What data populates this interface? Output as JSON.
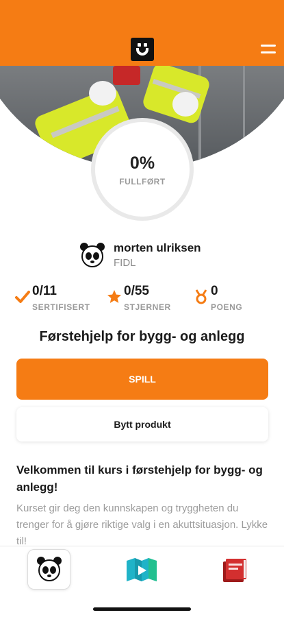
{
  "header": {
    "logo_icon": "smiley-logo-icon",
    "menu_icon": "hamburger-menu-icon",
    "accent_color": "#f57c14"
  },
  "progress": {
    "value": "0%",
    "label": "FULLFØRT"
  },
  "user": {
    "name": "morten ulriksen",
    "org": "FIDL",
    "avatar_icon": "panda-avatar-icon"
  },
  "stats": [
    {
      "value": "0/11",
      "label": "SERTIFISERT",
      "icon": "checkmark-icon"
    },
    {
      "value": "0/55",
      "label": "STJERNER",
      "icon": "star-icon"
    },
    {
      "value": "0",
      "label": "POENG",
      "icon": "medal-icon"
    }
  ],
  "course": {
    "title": "Førstehjelp for bygg- og anlegg"
  },
  "buttons": {
    "play": "SPILL",
    "switch_product": "Bytt produkt"
  },
  "welcome": {
    "title": "Velkommen til kurs i førstehjelp for bygg- og anlegg!",
    "body": "Kurset gir deg den kunnskapen og tryggheten du trenger for å gjøre riktige valg i en akuttsituasjon. Lykke til!"
  },
  "tabbar": [
    {
      "icon": "panda-icon"
    },
    {
      "icon": "video-map-icon"
    },
    {
      "icon": "book-icon"
    }
  ]
}
